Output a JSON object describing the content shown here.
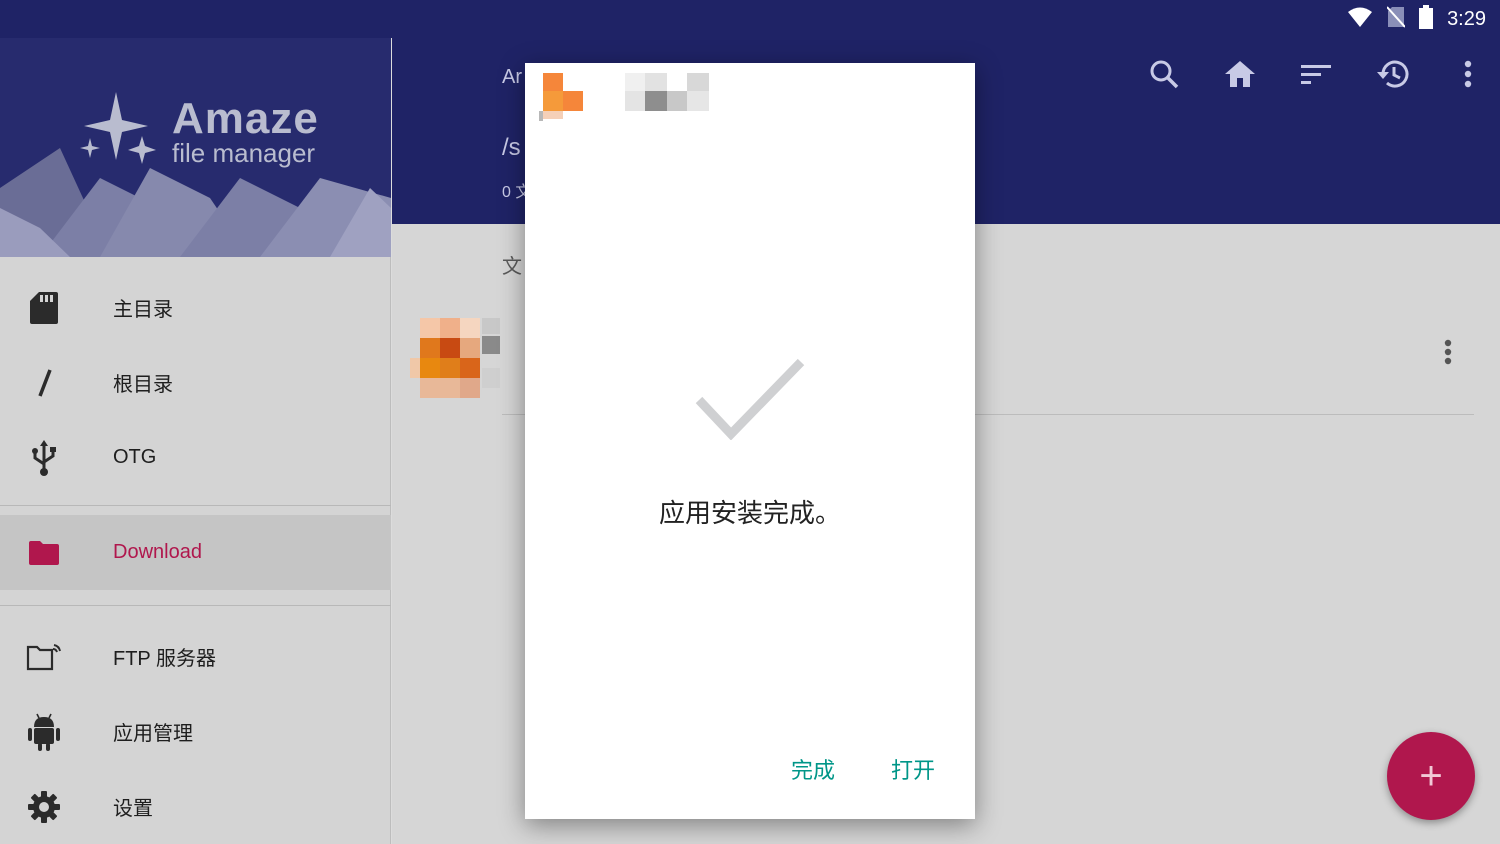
{
  "status_bar": {
    "time": "3:29"
  },
  "app_bar": {
    "title": "Ar",
    "path": "/s",
    "count": "0 文"
  },
  "drawer": {
    "logo": {
      "title": "Amaze",
      "subtitle": "file manager"
    },
    "items": [
      {
        "label": "主目录",
        "icon": "sd-card-icon"
      },
      {
        "label": "根目录",
        "icon": "root-slash-icon"
      },
      {
        "label": "OTG",
        "icon": "usb-icon"
      },
      {
        "label": "Download",
        "icon": "folder-icon",
        "active": true
      },
      {
        "label": "FTP 服务器",
        "icon": "ftp-folder-icon"
      },
      {
        "label": "应用管理",
        "icon": "android-icon"
      },
      {
        "label": "设置",
        "icon": "gear-icon"
      }
    ]
  },
  "content": {
    "section_label": "文"
  },
  "dialog": {
    "message": "应用安装完成。",
    "done_label": "完成",
    "open_label": "打开"
  },
  "colors": {
    "primary": "#1f2366",
    "accent": "#b0174d",
    "dialog_button": "#009688"
  }
}
